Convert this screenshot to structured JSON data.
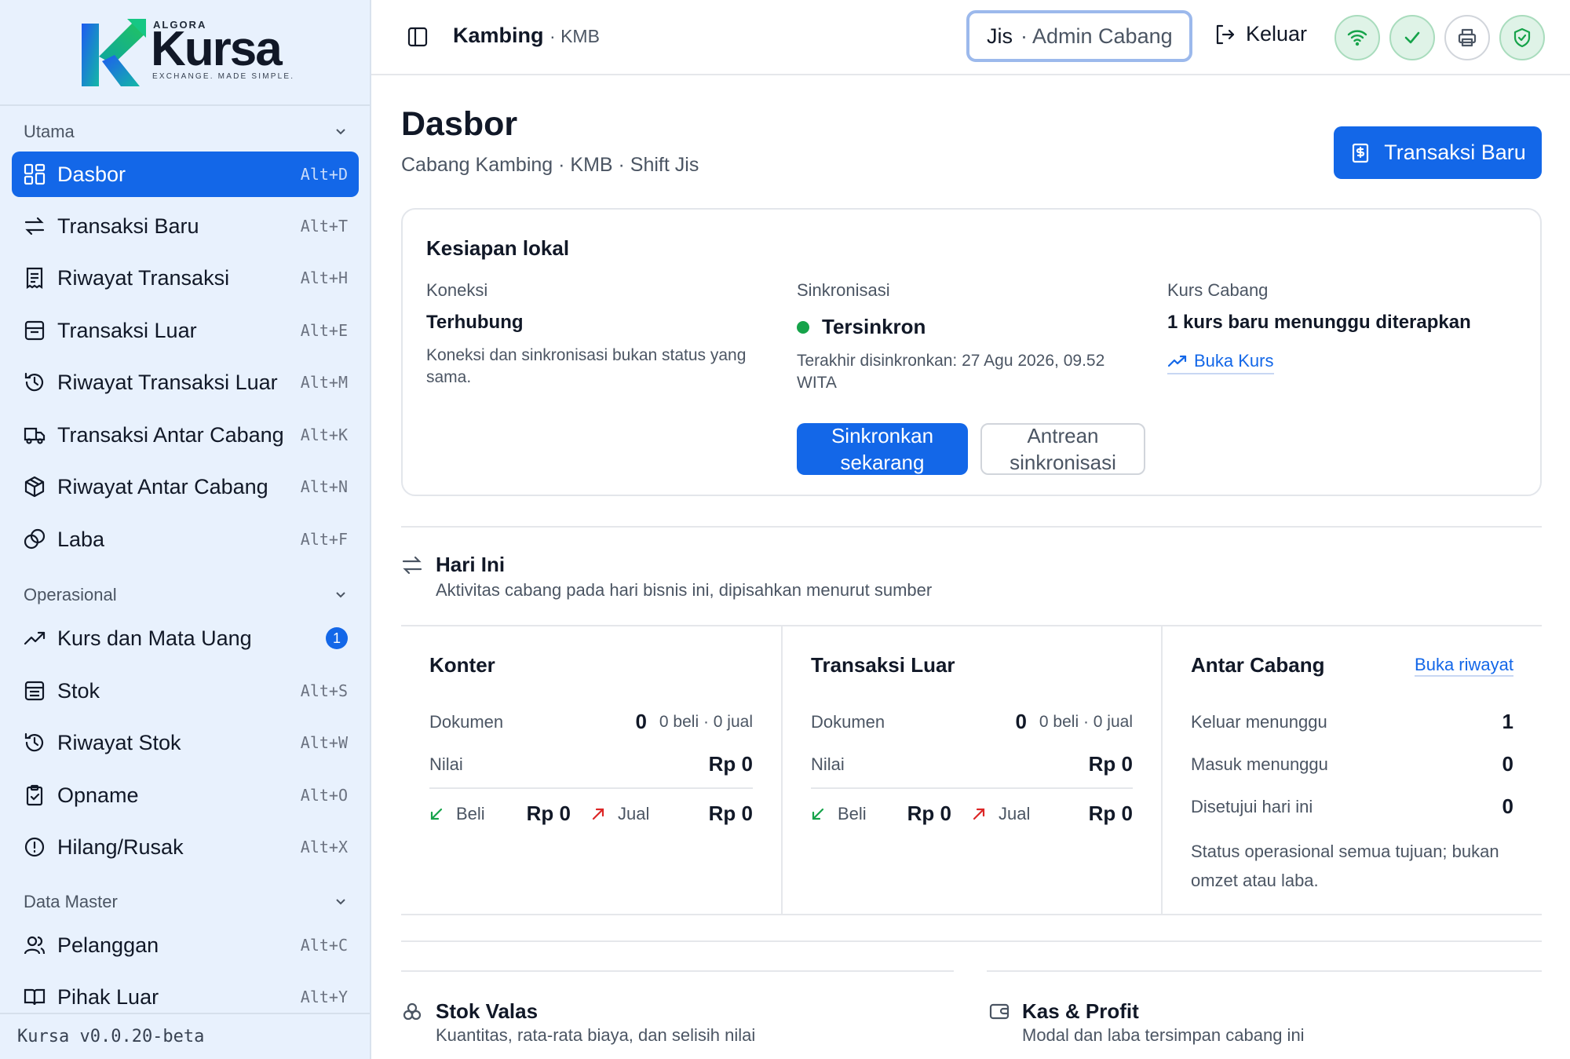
{
  "brand": {
    "top": "ALGORA",
    "name": "Kursa",
    "tagline": "EXCHANGE. MADE SIMPLE."
  },
  "sidebar": {
    "sections": [
      {
        "title": "Utama"
      },
      {
        "title": "Operasional"
      },
      {
        "title": "Data Master"
      }
    ],
    "items": [
      {
        "label": "Dasbor",
        "shortcut": "Alt+D",
        "icon": "grid-icon"
      },
      {
        "label": "Transaksi Baru",
        "shortcut": "Alt+T",
        "icon": "swap-icon"
      },
      {
        "label": "Riwayat Transaksi",
        "shortcut": "Alt+H",
        "icon": "receipt-icon"
      },
      {
        "label": "Transaksi Luar",
        "shortcut": "Alt+E",
        "icon": "inbox-icon"
      },
      {
        "label": "Riwayat Transaksi Luar",
        "shortcut": "Alt+M",
        "icon": "history-icon"
      },
      {
        "label": "Transaksi Antar Cabang",
        "shortcut": "Alt+K",
        "icon": "truck-icon"
      },
      {
        "label": "Riwayat Antar Cabang",
        "shortcut": "Alt+N",
        "icon": "package-icon"
      },
      {
        "label": "Laba",
        "shortcut": "Alt+F",
        "icon": "coins-icon"
      },
      {
        "label": "Kurs dan Mata Uang",
        "badge": "1",
        "icon": "trend-icon"
      },
      {
        "label": "Stok",
        "shortcut": "Alt+S",
        "icon": "stack-icon"
      },
      {
        "label": "Riwayat Stok",
        "shortcut": "Alt+W",
        "icon": "history-icon"
      },
      {
        "label": "Opname",
        "shortcut": "Alt+O",
        "icon": "clipboard-check-icon"
      },
      {
        "label": "Hilang/Rusak",
        "shortcut": "Alt+X",
        "icon": "alert-circle-icon"
      },
      {
        "label": "Pelanggan",
        "shortcut": "Alt+C",
        "icon": "users-icon"
      },
      {
        "label": "Pihak Luar",
        "shortcut": "Alt+Y",
        "icon": "book-icon"
      }
    ],
    "version": "Kursa v0.0.20-beta"
  },
  "topbar": {
    "branch": "Kambing",
    "branch_code": "· KMB",
    "user": "Jis",
    "role": "· Admin Cabang",
    "logout": "Keluar"
  },
  "page": {
    "title": "Dasbor",
    "subtitle": "Cabang Kambing · KMB · Shift Jis",
    "new_tx": "Transaksi Baru"
  },
  "readiness": {
    "title": "Kesiapan lokal",
    "connection_label": "Koneksi",
    "connection_value": "Terhubung",
    "connection_note": "Koneksi dan sinkronisasi bukan status yang sama.",
    "sync_label": "Sinkronisasi",
    "sync_value": "Tersinkron",
    "sync_last": "Terakhir disinkronkan: 27 Agu 2026, 09.52 WITA",
    "sync_now": "Sinkronkan sekarang",
    "sync_queue": "Antrean sinkronisasi",
    "rate_label": "Kurs Cabang",
    "rate_value": "1 kurs baru menunggu diterapkan",
    "rate_link": "Buka Kurs"
  },
  "today": {
    "title": "Hari Ini",
    "subtitle": "Aktivitas cabang pada hari bisnis ini, dipisahkan menurut sumber",
    "counter": {
      "title": "Konter",
      "docs_label": "Dokumen",
      "docs_value": "0",
      "docs_aux": "0 beli · 0 jual",
      "value_label": "Nilai",
      "value": "Rp 0",
      "buy_label": "Beli",
      "buy_value": "Rp 0",
      "sell_label": "Jual",
      "sell_value": "Rp 0"
    },
    "external": {
      "title": "Transaksi Luar",
      "docs_label": "Dokumen",
      "docs_value": "0",
      "docs_aux": "0 beli · 0 jual",
      "value_label": "Nilai",
      "value": "Rp 0",
      "buy_label": "Beli",
      "buy_value": "Rp 0",
      "sell_label": "Jual",
      "sell_value": "Rp 0"
    },
    "interbranch": {
      "title": "Antar Cabang",
      "link": "Buka riwayat",
      "out_label": "Keluar menunggu",
      "out_value": "1",
      "in_label": "Masuk menunggu",
      "in_value": "0",
      "approved_label": "Disetujui hari ini",
      "approved_value": "0",
      "note": "Status operasional semua tujuan; bukan omzet atau laba."
    }
  },
  "stock": {
    "title": "Stok Valas",
    "subtitle": "Kuantitas, rata-rata biaya, dan selisih nilai"
  },
  "cash": {
    "title": "Kas & Profit",
    "subtitle": "Modal dan laba tersimpan cabang ini"
  },
  "colors": {
    "accent": "#1367e8",
    "sidebar_bg": "#e8f1fd",
    "ok": "#16a34a",
    "buy": "#16a34a",
    "sell": "#dc2626"
  }
}
